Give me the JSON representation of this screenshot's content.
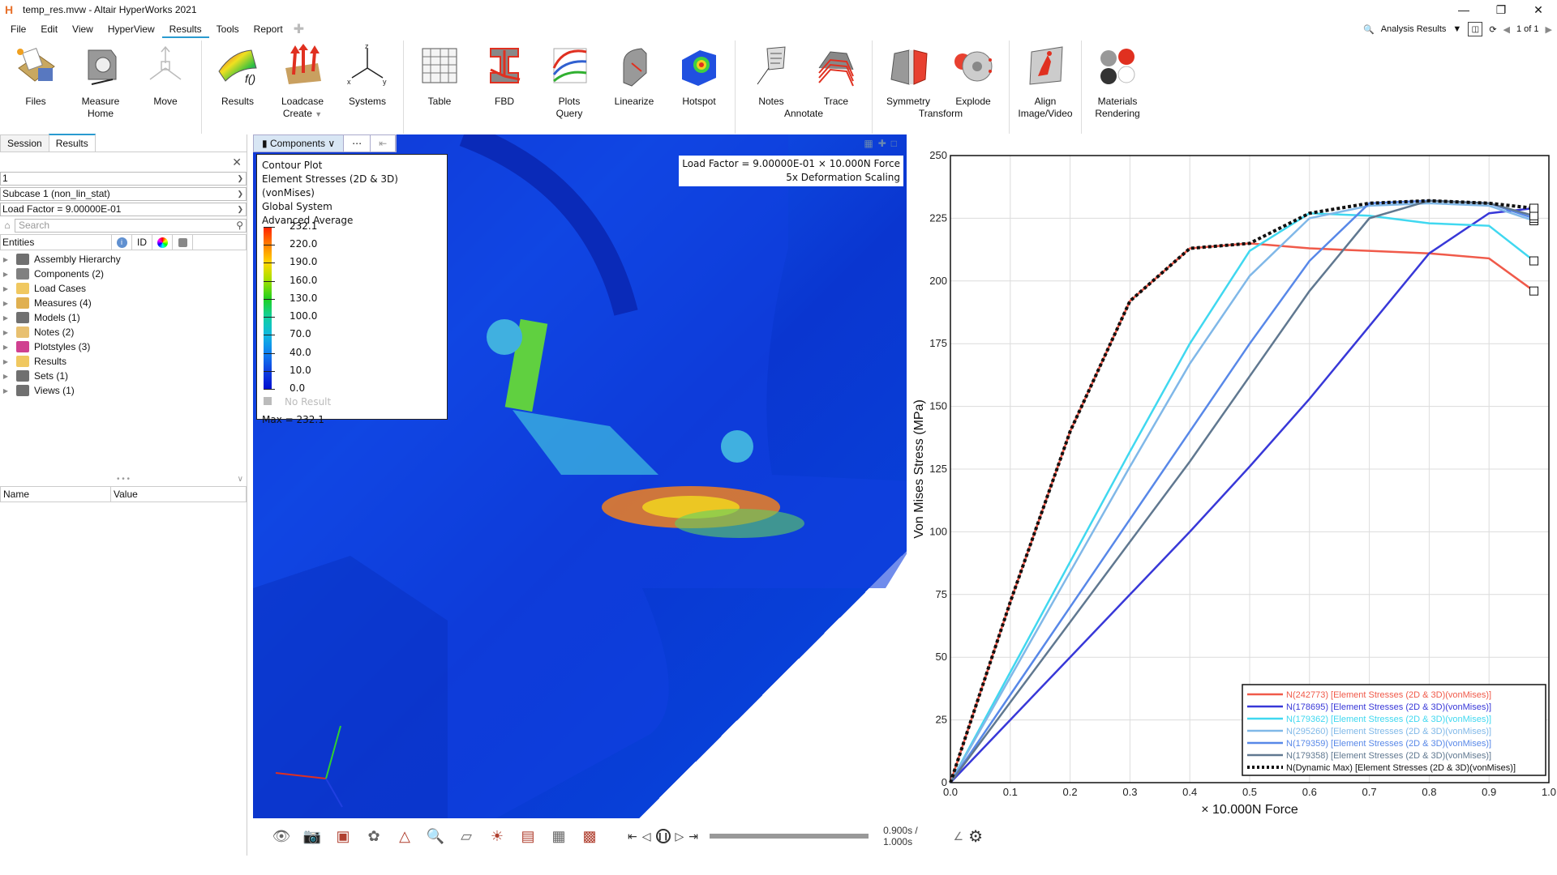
{
  "window": {
    "title": "temp_res.mvw - Altair HyperWorks 2021",
    "controls": [
      "minimize",
      "restore",
      "close"
    ]
  },
  "menubar": {
    "items": [
      "File",
      "Edit",
      "View",
      "HyperView",
      "Results",
      "Tools",
      "Report"
    ],
    "active": "Results"
  },
  "topright": {
    "search_icon": "search-icon",
    "page_selector": "Analysis Results",
    "page_counter": "1 of 1"
  },
  "ribbon": {
    "groups": [
      {
        "label": "Home",
        "tools": [
          "Files",
          "Measure",
          "Move"
        ]
      },
      {
        "label": "Create",
        "tools": [
          "Results",
          "Loadcase",
          "Systems"
        ]
      },
      {
        "label": "Query",
        "tools": [
          "Table",
          "FBD",
          "Plots",
          "Linearize",
          "Hotspot"
        ]
      },
      {
        "label": "Annotate",
        "tools": [
          "Notes",
          "Trace"
        ]
      },
      {
        "label": "Transform",
        "tools": [
          "Symmetry",
          "Explode"
        ]
      },
      {
        "label": "Image/Video",
        "tools": [
          "Align"
        ]
      },
      {
        "label": "Rendering",
        "tools": [
          "Materials"
        ]
      }
    ]
  },
  "leftpanel": {
    "tabs": [
      "Session",
      "Results"
    ],
    "active_tab": "Results",
    "model_select": "1",
    "subcase_select": "Subcase 1 (non_lin_stat)",
    "step_select": "Load Factor =  9.00000E-01",
    "search_placeholder": "Search",
    "entities_header": "Entities",
    "id_header": "ID",
    "tree": [
      {
        "label": "Assembly Hierarchy",
        "color": "#707070"
      },
      {
        "label": "Components (2)",
        "color": "#808080"
      },
      {
        "label": "Load Cases",
        "color": "#f0c860"
      },
      {
        "label": "Measures (4)",
        "color": "#e0b050"
      },
      {
        "label": "Models (1)",
        "color": "#707070"
      },
      {
        "label": "Notes (2)",
        "color": "#e8c070"
      },
      {
        "label": "Plotstyles (3)",
        "color": "#d04090"
      },
      {
        "label": "Results",
        "color": "#f0c860"
      },
      {
        "label": "Sets (1)",
        "color": "#707070"
      },
      {
        "label": "Views (1)",
        "color": "#707070"
      }
    ],
    "props_headers": [
      "Name",
      "Value"
    ]
  },
  "viewport": {
    "toolbar_component": "Components",
    "legend": {
      "lines": [
        "Contour Plot",
        "Element Stresses (2D & 3D)(vonMises)",
        "Global System",
        "Advanced Average"
      ],
      "values": [
        "232.1",
        "220.0",
        "190.0",
        "160.0",
        "130.0",
        "100.0",
        "70.0",
        "40.0",
        "10.0",
        "0.0"
      ],
      "no_result": "No Result",
      "max": "Max = 232.1"
    },
    "annotation": [
      "Load Factor =  9.00000E-01 × 10.000N Force",
      "5x Deformation Scaling"
    ]
  },
  "animation": {
    "time": "0.900s / 1.000s",
    "progress": 0.9
  },
  "bottom_icons": [
    "eye-icon",
    "camera-icon",
    "cube-icon",
    "color-wheel-icon",
    "axes-icon",
    "zoom-icon",
    "section-icon",
    "contour-icon",
    "deform-icon",
    "frame-icon",
    "box-icon"
  ],
  "chart_data": {
    "type": "line",
    "title": "",
    "xlabel": "× 10.000N Force",
    "ylabel": "Von Mises Stress (MPa)",
    "xlim": [
      0,
      1.0
    ],
    "ylim": [
      0,
      250
    ],
    "xticks": [
      "0.0",
      "0.1",
      "0.2",
      "0.3",
      "0.4",
      "0.5",
      "0.6",
      "0.7",
      "0.8",
      "0.9",
      "1.0"
    ],
    "yticks": [
      "0",
      "25",
      "50",
      "75",
      "100",
      "125",
      "150",
      "175",
      "200",
      "225",
      "250"
    ],
    "grid": true,
    "legend_position": "bottom-right",
    "x": [
      0,
      0.1,
      0.2,
      0.3,
      0.4,
      0.5,
      0.6,
      0.7,
      0.8,
      0.9,
      0.975
    ],
    "series": [
      {
        "name": "N(242773) [Element Stresses (2D & 3D)(vonMises)]",
        "color": "#f05a4a",
        "dash": false,
        "values": [
          0,
          72,
          140,
          192,
          213,
          215,
          213,
          212,
          211,
          209,
          196
        ]
      },
      {
        "name": "N(178695) [Element Stresses (2D & 3D)(vonMises)]",
        "color": "#3838d8",
        "dash": false,
        "values": [
          0,
          25,
          50,
          75,
          100,
          126,
          153,
          182,
          211,
          227,
          229
        ]
      },
      {
        "name": "N(179362) [Element Stresses (2D & 3D)(vonMises)]",
        "color": "#40d8f0",
        "dash": false,
        "values": [
          0,
          44,
          88,
          132,
          175,
          212,
          227,
          226,
          223,
          222,
          208
        ]
      },
      {
        "name": "N(295260) [Element Stresses (2D & 3D)(vonMises)]",
        "color": "#80b8e8",
        "dash": false,
        "values": [
          0,
          42,
          84,
          126,
          167,
          202,
          225,
          230,
          231,
          230,
          224
        ]
      },
      {
        "name": "N(179359) [Element Stresses (2D & 3D)(vonMises)]",
        "color": "#5888e8",
        "dash": false,
        "values": [
          0,
          35,
          70,
          105,
          140,
          175,
          208,
          231,
          232,
          231,
          225
        ]
      },
      {
        "name": "N(179358) [Element Stresses (2D & 3D)(vonMises)]",
        "color": "#607890",
        "dash": false,
        "values": [
          0,
          32,
          64,
          96,
          128,
          162,
          196,
          225,
          232,
          231,
          226
        ]
      },
      {
        "name": "N(Dynamic Max) [Element Stresses (2D & 3D)(vonMises)]",
        "color": "#111111",
        "dash": true,
        "values": [
          0,
          72,
          140,
          192,
          213,
          215,
          227,
          231,
          232,
          231,
          229
        ]
      }
    ]
  }
}
